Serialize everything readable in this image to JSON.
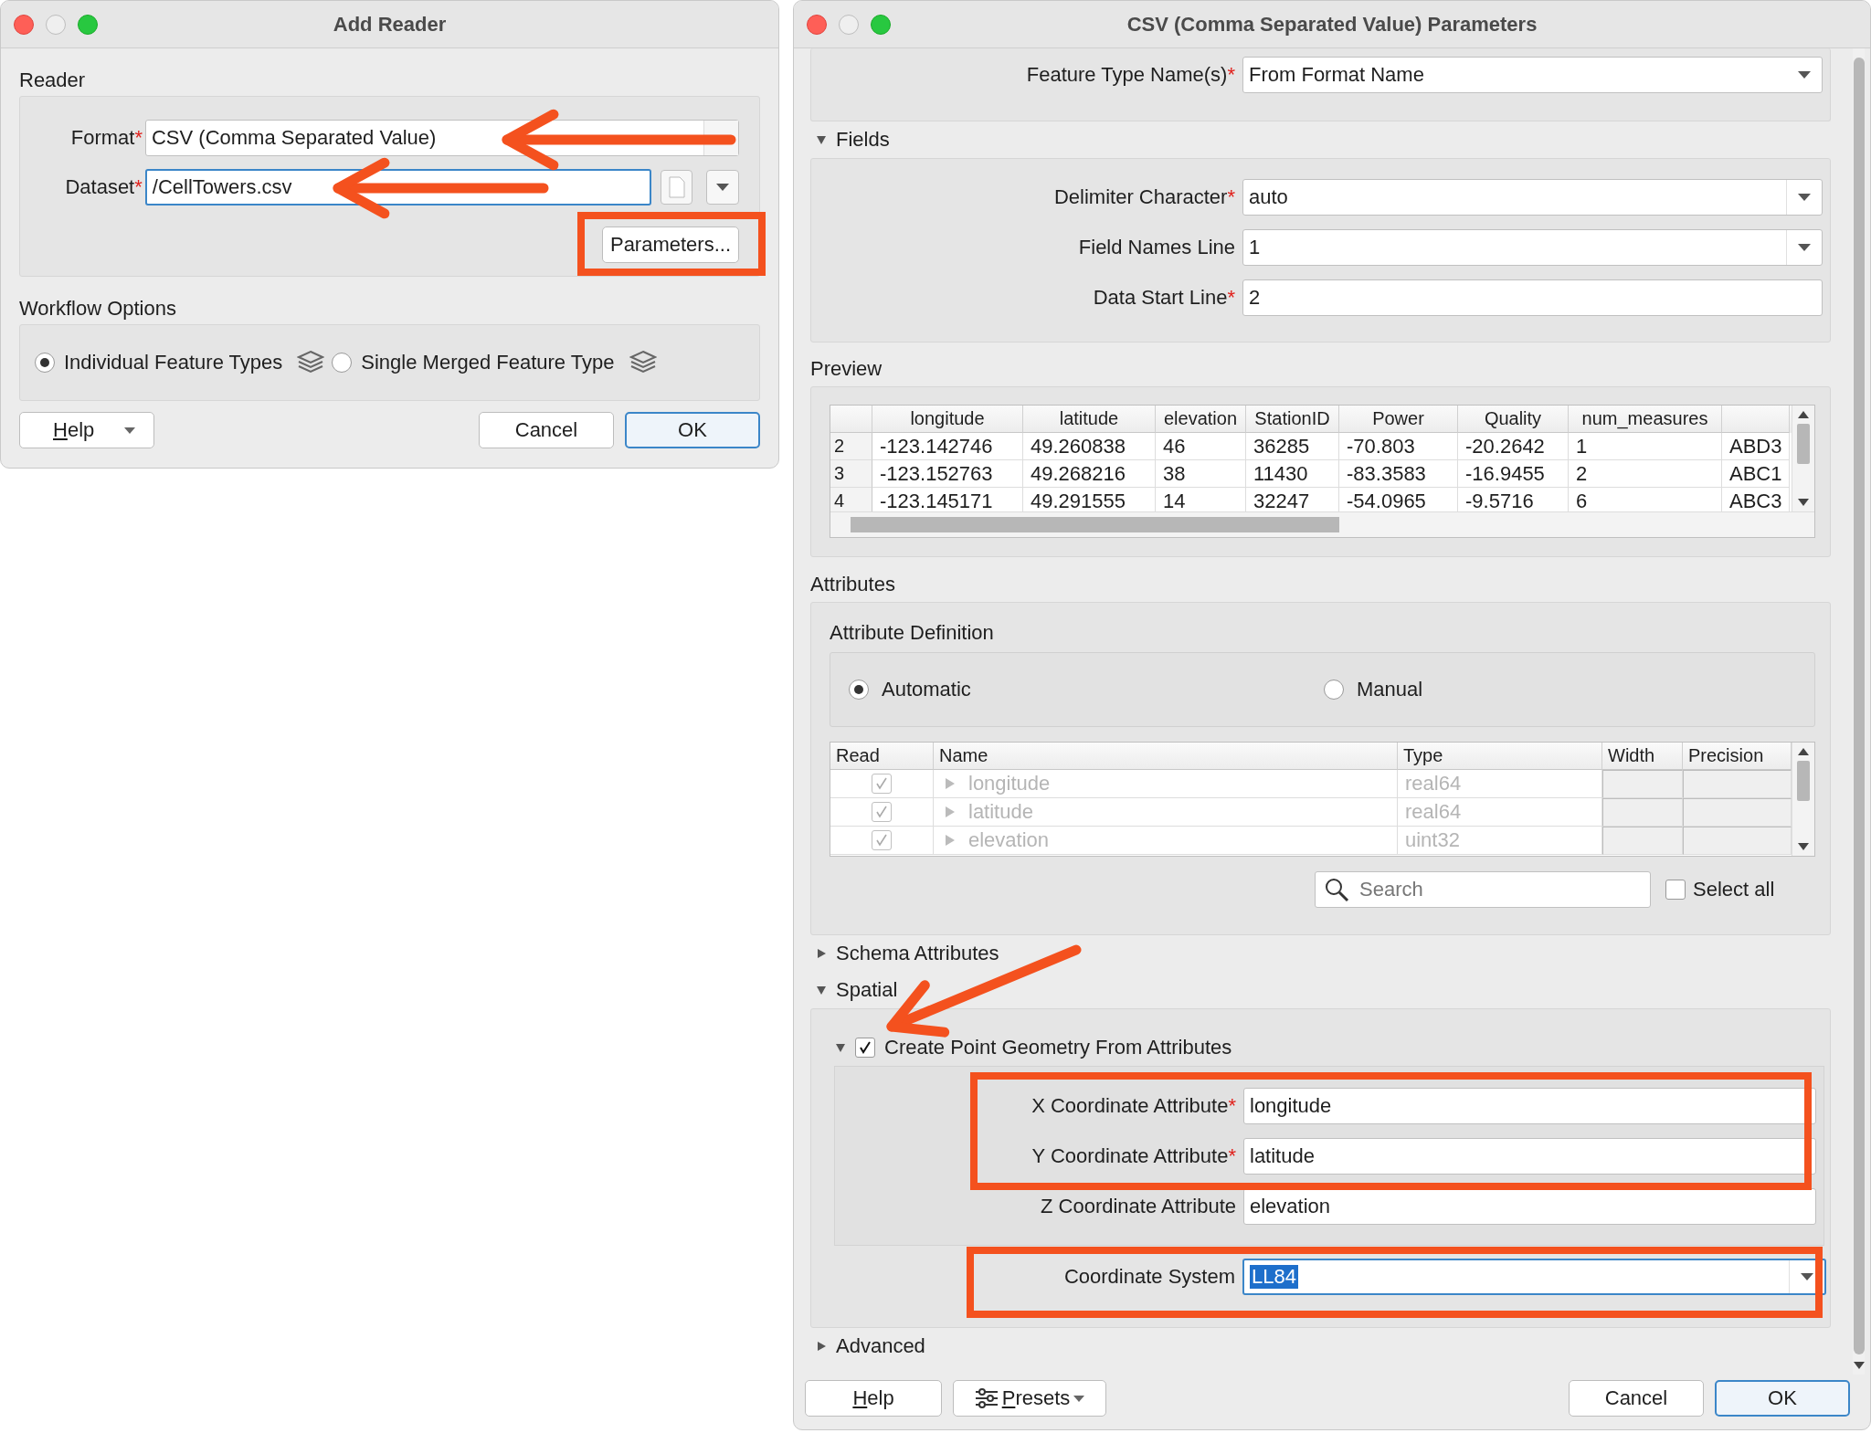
{
  "add_reader": {
    "title": "Add Reader",
    "reader": {
      "heading": "Reader",
      "format": {
        "label": "Format",
        "mark": "*",
        "value": "CSV (Comma Separated Value)"
      },
      "dataset": {
        "label": "Dataset",
        "mark": "*",
        "value": "/CellTowers.csv"
      },
      "parameters_button": "Parameters..."
    },
    "workflow": {
      "heading": "Workflow Options",
      "options": [
        {
          "label": "Individual Feature Types",
          "selected": true
        },
        {
          "label": "Single Merged Feature Type",
          "selected": false
        }
      ]
    },
    "buttons": {
      "help": "Help",
      "cancel": "Cancel",
      "ok": "OK"
    }
  },
  "parameters": {
    "title": "CSV (Comma Separated Value) Parameters",
    "feature_type": {
      "label": "Feature Type Name(s)",
      "mark": "*",
      "value": "From Format Name"
    },
    "fields_section": {
      "heading": "Fields",
      "expanded": true,
      "rows": [
        {
          "label": "Delimiter Character",
          "mark": "*",
          "value": "auto",
          "kind": "dropdown"
        },
        {
          "label": "Field Names Line",
          "value": "1",
          "kind": "dropdown"
        },
        {
          "label": "Data Start Line",
          "mark": "*",
          "value": "2",
          "kind": "text"
        }
      ]
    },
    "preview": {
      "heading": "Preview",
      "columns": [
        "longitude",
        "latitude",
        "elevation",
        "StationID",
        "Power",
        "Quality",
        "num_measures"
      ],
      "rows": [
        {
          "num": "2",
          "cells": [
            "-123.142746",
            "49.260838",
            "46",
            "36285",
            "-70.803",
            "-20.2642",
            "1",
            "ABD3"
          ]
        },
        {
          "num": "3",
          "cells": [
            "-123.152763",
            "49.268216",
            "38",
            "11430",
            "-83.3583",
            "-16.9455",
            "2",
            "ABC1"
          ]
        },
        {
          "num": "4",
          "cells": [
            "-123.145171",
            "49.291555",
            "14",
            "32247",
            "-54.0965",
            "-9.5716",
            "6",
            "ABC3"
          ]
        }
      ]
    },
    "attributes": {
      "heading": "Attributes",
      "definition_label": "Attribute Definition",
      "modes": [
        {
          "label": "Automatic",
          "selected": true
        },
        {
          "label": "Manual",
          "selected": false
        }
      ],
      "columns": [
        "Read",
        "Name",
        "Type",
        "Width",
        "Precision"
      ],
      "rows": [
        {
          "read": true,
          "disabled": true,
          "name": "longitude",
          "type": "real64"
        },
        {
          "read": true,
          "disabled": true,
          "name": "latitude",
          "type": "real64"
        },
        {
          "read": true,
          "disabled": true,
          "name": "elevation",
          "type": "uint32"
        }
      ],
      "search": {
        "placeholder": "Search"
      },
      "select_all": {
        "label": "Select all",
        "checked": false
      }
    },
    "schema_section": {
      "heading": "Schema Attributes",
      "expanded": false
    },
    "spatial_section": {
      "heading": "Spatial",
      "expanded": true,
      "create_point": {
        "label": "Create Point Geometry From Attributes",
        "checked": true,
        "expanded": true
      },
      "rows": [
        {
          "label": "X Coordinate Attribute",
          "mark": "*",
          "value": "longitude"
        },
        {
          "label": "Y Coordinate Attribute",
          "mark": "*",
          "value": "latitude"
        },
        {
          "label": "Z Coordinate Attribute",
          "value": "elevation"
        }
      ],
      "coordinate_system": {
        "label": "Coordinate System",
        "value": "LL84",
        "highlighted": true
      }
    },
    "advanced_section": {
      "heading": "Advanced",
      "expanded": false
    },
    "buttons": {
      "help": "Help",
      "presets": "Presets",
      "cancel": "Cancel",
      "ok": "OK"
    }
  }
}
